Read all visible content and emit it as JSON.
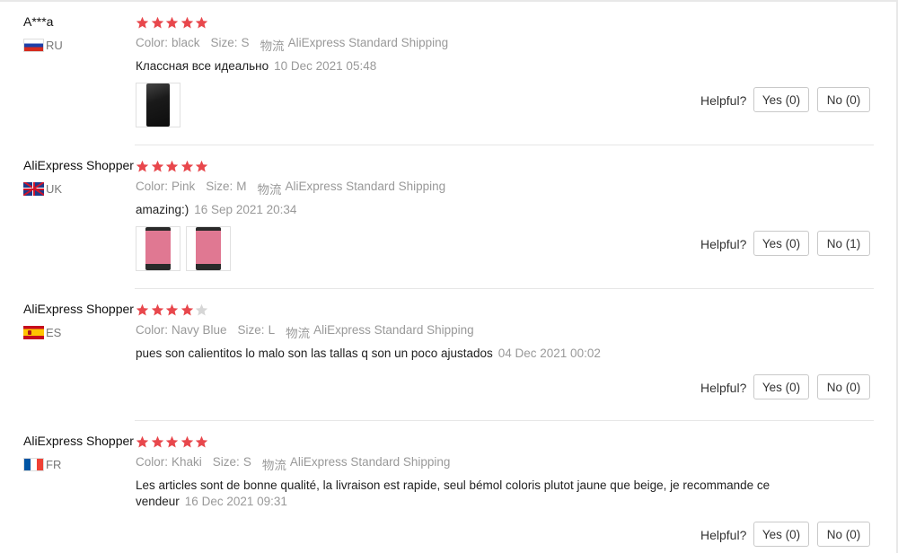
{
  "labels": {
    "color": "Color:",
    "size": "Size:",
    "shipping_prefix": "物流",
    "helpful": "Helpful?"
  },
  "colors": {
    "star_on": "#e8474c",
    "star_off": "#d6d6d6"
  },
  "reviews": [
    {
      "user": "A***a",
      "country": "RU",
      "flag": "flag-ru",
      "rating": 5,
      "color": "black",
      "size": "S",
      "shipping": "AliExpress Standard Shipping",
      "comment": "Классная все идеально",
      "date": "10 Dec 2021 05:48",
      "photos": [
        "black-hoodie-photo"
      ],
      "yes": "Yes (0)",
      "no": "No (0)"
    },
    {
      "user": "AliExpress Shopper",
      "country": "UK",
      "flag": "flag-uk",
      "rating": 5,
      "color": "Pink",
      "size": "M",
      "shipping": "AliExpress Standard Shipping",
      "comment": "amazing:)",
      "date": "16 Sep 2021 20:34",
      "photos": [
        "pink-hoodie-photo-1",
        "pink-hoodie-photo-2"
      ],
      "yes": "Yes (0)",
      "no": "No (1)"
    },
    {
      "user": "AliExpress Shopper",
      "country": "ES",
      "flag": "flag-es",
      "rating": 4,
      "color": "Navy Blue",
      "size": "L",
      "shipping": "AliExpress Standard Shipping",
      "comment": "pues son calientitos lo malo son las tallas q son un poco ajustados",
      "date": "04 Dec 2021 00:02",
      "photos": [],
      "yes": "Yes (0)",
      "no": "No (0)"
    },
    {
      "user": "AliExpress Shopper",
      "country": "FR",
      "flag": "flag-fr",
      "rating": 5,
      "color": "Khaki",
      "size": "S",
      "shipping": "AliExpress Standard Shipping",
      "comment": "Les articles sont de bonne qualité, la livraison est rapide, seul bémol coloris plutot jaune que beige, je recommande ce vendeur",
      "date": "16 Dec 2021 09:31",
      "photos": [],
      "yes": "Yes (0)",
      "no": "No (0)"
    }
  ]
}
